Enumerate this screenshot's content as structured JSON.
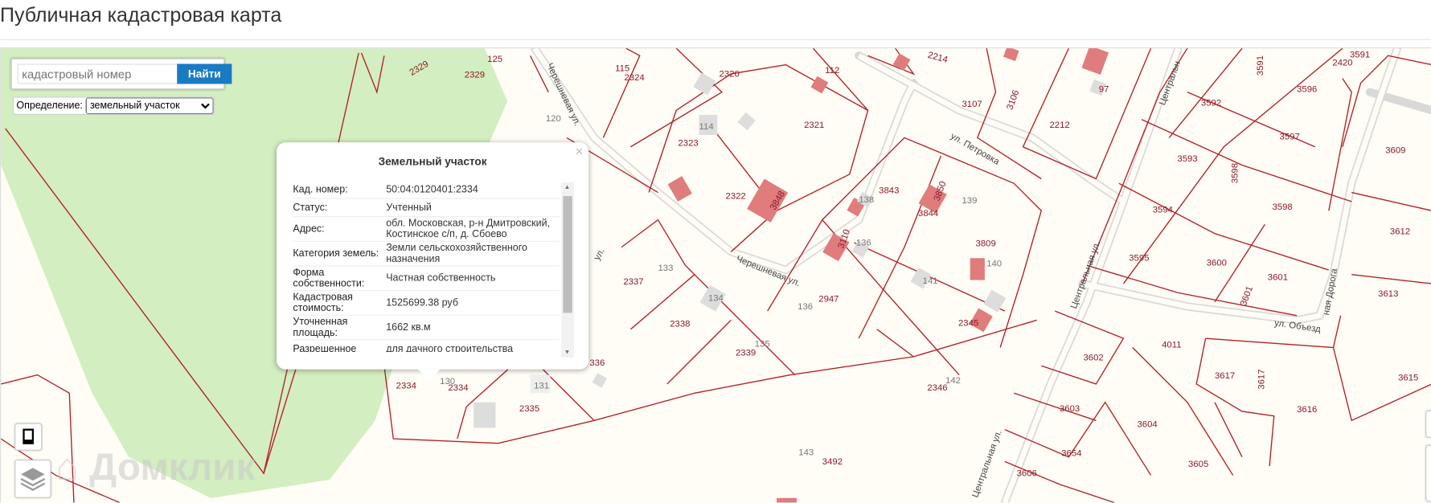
{
  "header": {
    "title": "Публичная кадастровая карта"
  },
  "search": {
    "placeholder": "кадастровый номер",
    "button": "Найти"
  },
  "definition": {
    "label": "Определение:",
    "selected": "земельный участок"
  },
  "popup": {
    "title": "Земельный участок",
    "rows": [
      {
        "label": "Кад. номер:",
        "value": "50:04:0120401:2334"
      },
      {
        "label": "Статус:",
        "value": "Учтенный"
      },
      {
        "label": "Адрес:",
        "value": "обл. Московская, р-н Дмитровский, Костинское с/п, д. Сбоево"
      },
      {
        "label": "Категория земель:",
        "value": "Земли сельскохозяйственного назначения"
      },
      {
        "label": "Форма собственности:",
        "value": "Частная собственность"
      },
      {
        "label": "Кадастровая стоимость:",
        "value": "1525699.38 руб"
      },
      {
        "label": "Уточненная площадь:",
        "value": "1662 кв.м"
      },
      {
        "label": "Разрешенное",
        "value": "для дачного строительства"
      }
    ]
  },
  "watermark": "Домклик",
  "map": {
    "parcels": [
      "2329",
      "2329",
      "125",
      "115",
      "2324",
      "2320",
      "112",
      "2214",
      "3107",
      "3106",
      "2212",
      "2420",
      "3591",
      "3591",
      "3596",
      "3592",
      "3597",
      "3609",
      "3593",
      "3598",
      "3598",
      "3594",
      "3612",
      "3595",
      "3600",
      "3601",
      "3601",
      "3613",
      "4011",
      "3602",
      "3617",
      "3617",
      "3615",
      "3616",
      "3603",
      "3604",
      "3654",
      "3605",
      "2323",
      "2321",
      "2322",
      "3848",
      "3843",
      "3850",
      "3844",
      "3809",
      "3110",
      "2947",
      "2345",
      "2346",
      "2337",
      "2338",
      "2339",
      "2334",
      "2334",
      "2335",
      "336",
      "3492",
      "3606",
      "97"
    ],
    "house_numbers": [
      "114",
      "138",
      "139",
      "140",
      "136",
      "141",
      "136",
      "142",
      "133",
      "134",
      "135",
      "120",
      "130",
      "131",
      "143"
    ],
    "streets": [
      "ул. Петровка",
      "Черешневая ул.",
      "Черешневая ул.",
      "Центральная ул.",
      "Центральная ул.",
      "Центральн",
      "ул. Объезд",
      "ная Дорога",
      "ул."
    ]
  },
  "colors": {
    "parcel_line": "#b3202a",
    "forest": "#d3eec0",
    "button": "#1a7ac4",
    "building": "#e07c7c"
  }
}
